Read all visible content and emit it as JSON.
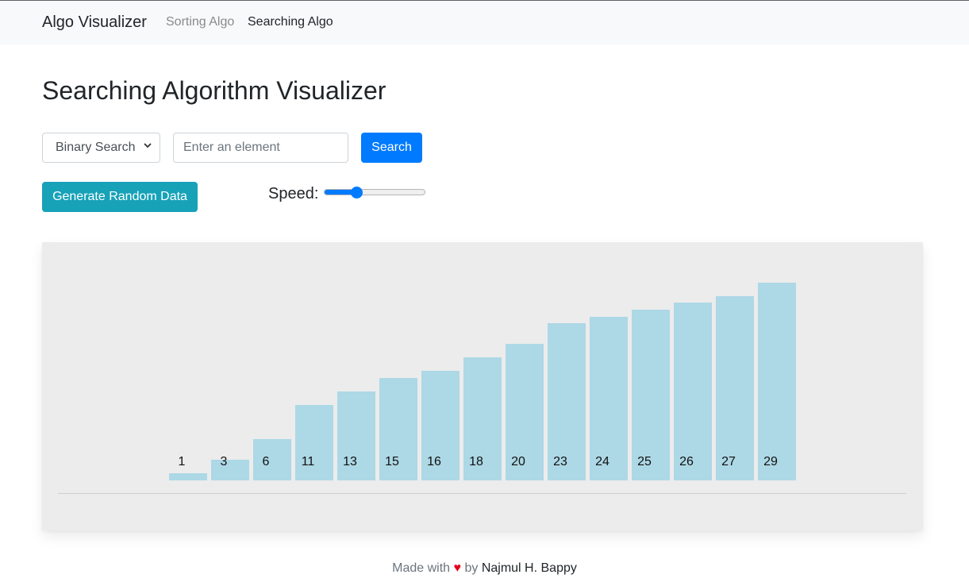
{
  "navbar": {
    "brand": "Algo Visualizer",
    "links": [
      {
        "label": "Sorting Algo",
        "active": false
      },
      {
        "label": "Searching Algo",
        "active": true
      }
    ]
  },
  "page": {
    "title": "Searching Algorithm Visualizer"
  },
  "controls": {
    "algorithm_selected": "Binary Search",
    "element_placeholder": "Enter an element",
    "element_value": "",
    "search_label": "Search",
    "generate_label": "Generate Random Data",
    "speed_label": "Speed:",
    "speed_value_fraction": 0.3
  },
  "chart_data": {
    "type": "bar",
    "categories": [
      "1",
      "3",
      "6",
      "11",
      "13",
      "15",
      "16",
      "18",
      "20",
      "23",
      "24",
      "25",
      "26",
      "27",
      "29"
    ],
    "values": [
      1,
      3,
      6,
      11,
      13,
      15,
      16,
      18,
      20,
      23,
      24,
      25,
      26,
      27,
      29
    ],
    "bar_color": "#add8e6",
    "sorted": true
  },
  "footer": {
    "prefix": "Made with",
    "heart": "♥",
    "middle": "by",
    "author": "Najmul H. Bappy"
  },
  "colors": {
    "primary": "#007bff",
    "info": "#17a2b8",
    "heart": "#e3001b",
    "panel": "#ececec"
  }
}
